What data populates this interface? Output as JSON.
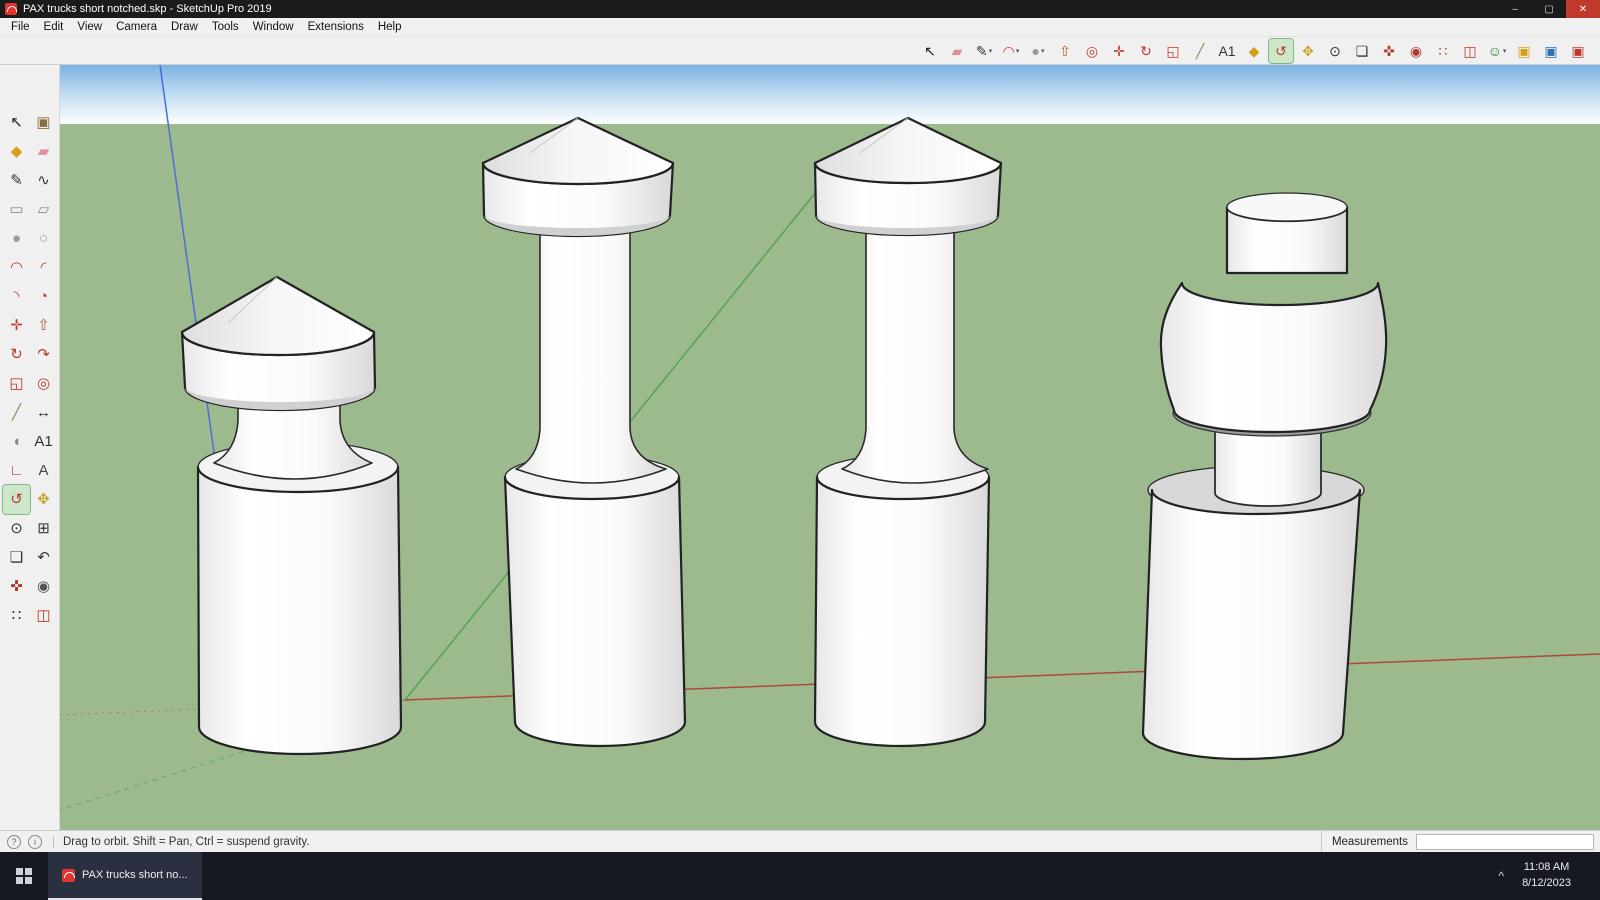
{
  "window": {
    "title": "PAX trucks short notched.skp - SketchUp Pro 2019",
    "controls": {
      "minimize": "–",
      "maximize": "▢",
      "close": "✕"
    }
  },
  "menu": {
    "items": [
      {
        "name": "menu-file",
        "label": "File"
      },
      {
        "name": "menu-edit",
        "label": "Edit"
      },
      {
        "name": "menu-view",
        "label": "View"
      },
      {
        "name": "menu-camera",
        "label": "Camera"
      },
      {
        "name": "menu-draw",
        "label": "Draw"
      },
      {
        "name": "menu-tools",
        "label": "Tools"
      },
      {
        "name": "menu-window",
        "label": "Window"
      },
      {
        "name": "menu-extensions",
        "label": "Extensions"
      },
      {
        "name": "menu-help",
        "label": "Help"
      }
    ]
  },
  "toolbar": {
    "icons": [
      {
        "name": "select-tool",
        "glyph": "↖",
        "color": "#1a1a1a"
      },
      {
        "name": "eraser-tool",
        "glyph": "▰",
        "color": "#e08e9b"
      },
      {
        "name": "line-tool",
        "glyph": "✎",
        "color": "#333333",
        "dropdown": true
      },
      {
        "name": "arc-tool",
        "glyph": "◠",
        "color": "#c0392b",
        "dropdown": true
      },
      {
        "name": "shapes-tool",
        "glyph": "●",
        "color": "#9a9a9a",
        "dropdown": true
      },
      {
        "name": "push-pull-tool",
        "glyph": "⇧",
        "color": "#b35c2a"
      },
      {
        "name": "offset-tool",
        "glyph": "◎",
        "color": "#c0392b"
      },
      {
        "name": "move-tool",
        "glyph": "✛",
        "color": "#c0392b"
      },
      {
        "name": "rotate-tool",
        "glyph": "↻",
        "color": "#c0392b"
      },
      {
        "name": "scale-tool",
        "glyph": "◱",
        "color": "#c0392b"
      },
      {
        "name": "tape-measure-tool",
        "glyph": "╱",
        "color": "#8a8a5a"
      },
      {
        "name": "text-tool",
        "glyph": "A1",
        "color": "#333333"
      },
      {
        "name": "paint-bucket-tool",
        "glyph": "◆",
        "color": "#d4a017"
      },
      {
        "name": "orbit-tool",
        "glyph": "↺",
        "color": "#c0392b",
        "active": true
      },
      {
        "name": "pan-tool",
        "glyph": "✥",
        "color": "#c9a227"
      },
      {
        "name": "zoom-tool",
        "glyph": "⊙",
        "color": "#333333"
      },
      {
        "name": "zoom-extents-tool",
        "glyph": "❏",
        "color": "#333333"
      },
      {
        "name": "position-camera-tool",
        "glyph": "✜",
        "color": "#b03a2e"
      },
      {
        "name": "look-around-tool",
        "glyph": "◉",
        "color": "#b03a2e"
      },
      {
        "name": "walk-tool",
        "glyph": "∷",
        "color": "#b03a2e"
      },
      {
        "name": "section-plane-tool",
        "glyph": "◫",
        "color": "#b03a2e"
      },
      {
        "name": "sign-in-avatar",
        "glyph": "☺",
        "color": "#2e7d32",
        "dropdown": true
      },
      {
        "name": "3d-warehouse-tool",
        "glyph": "▣",
        "color": "#d4a017"
      },
      {
        "name": "extension-warehouse-tool",
        "glyph": "▣",
        "color": "#2f6fb3"
      },
      {
        "name": "send-to-layout-tool",
        "glyph": "▣",
        "color": "#c0392b"
      }
    ]
  },
  "tool_palette": {
    "icons": [
      {
        "name": "select-tool",
        "glyph": "↖",
        "color": "#1a1a1a"
      },
      {
        "name": "make-component-tool",
        "glyph": "▣",
        "color": "#8a6d3b"
      },
      {
        "name": "paint-bucket-tool",
        "glyph": "◆",
        "color": "#d4a017"
      },
      {
        "name": "eraser-tool",
        "glyph": "▰",
        "color": "#e08e9b"
      },
      {
        "name": "line-tool",
        "glyph": "✎",
        "color": "#333333"
      },
      {
        "name": "freehand-tool",
        "glyph": "∿",
        "color": "#333333"
      },
      {
        "name": "rectangle-tool",
        "glyph": "▭",
        "color": "#8a8a8a"
      },
      {
        "name": "rotated-rectangle-tool",
        "glyph": "▱",
        "color": "#8a8a8a"
      },
      {
        "name": "circle-tool",
        "glyph": "●",
        "color": "#9a9a9a"
      },
      {
        "name": "polygon-tool",
        "glyph": "○",
        "color": "#9a9a9a"
      },
      {
        "name": "arc-tool",
        "glyph": "◠",
        "color": "#c0392b"
      },
      {
        "name": "two-point-arc-tool",
        "glyph": "◜",
        "color": "#c0392b"
      },
      {
        "name": "three-point-arc-tool",
        "glyph": "◝",
        "color": "#c0392b"
      },
      {
        "name": "pie-tool",
        "glyph": "◔",
        "color": "#c0392b"
      },
      {
        "name": "move-tool",
        "glyph": "✛",
        "color": "#c0392b"
      },
      {
        "name": "push-pull-tool",
        "glyph": "⇧",
        "color": "#b35c2a"
      },
      {
        "name": "rotate-tool",
        "glyph": "↻",
        "color": "#c0392b"
      },
      {
        "name": "follow-me-tool",
        "glyph": "↷",
        "color": "#c0392b"
      },
      {
        "name": "scale-tool",
        "glyph": "◱",
        "color": "#c0392b"
      },
      {
        "name": "offset-tool",
        "glyph": "◎",
        "color": "#c0392b"
      },
      {
        "name": "tape-measure-tool",
        "glyph": "╱",
        "color": "#8a8a5a"
      },
      {
        "name": "dimension-tool",
        "glyph": "↔",
        "color": "#333333"
      },
      {
        "name": "protractor-tool",
        "glyph": "◖",
        "color": "#888888"
      },
      {
        "name": "text-tool",
        "glyph": "A1",
        "color": "#333333"
      },
      {
        "name": "axes-tool",
        "glyph": "∟",
        "color": "#c0392b"
      },
      {
        "name": "3d-text-tool",
        "glyph": "A",
        "color": "#444444"
      },
      {
        "name": "orbit-tool",
        "glyph": "↺",
        "color": "#c0392b",
        "active": true
      },
      {
        "name": "pan-tool",
        "glyph": "✥",
        "color": "#c9a227"
      },
      {
        "name": "zoom-tool",
        "glyph": "⊙",
        "color": "#333333"
      },
      {
        "name": "zoom-window-tool",
        "glyph": "⊞",
        "color": "#333333"
      },
      {
        "name": "zoom-extents-tool",
        "glyph": "❏",
        "color": "#333333"
      },
      {
        "name": "previous-view-tool",
        "glyph": "↶",
        "color": "#333333"
      },
      {
        "name": "position-camera-tool",
        "glyph": "✜",
        "color": "#b03a2e"
      },
      {
        "name": "look-around-tool",
        "glyph": "◉",
        "color": "#555555"
      },
      {
        "name": "walk-tool",
        "glyph": "∷",
        "color": "#333333"
      },
      {
        "name": "section-plane-tool",
        "glyph": "◫",
        "color": "#c0392b"
      }
    ]
  },
  "viewport": {
    "sky": {
      "top": "#79b2e2",
      "mid": "#c2ddf3",
      "bottom": "#fdfefe"
    },
    "ground_color": "#9cba8e",
    "axes": {
      "blue_color": "#4a6fd6",
      "green_color": "#57a353",
      "red_color": "#b0473c"
    },
    "models": [
      "bollard-short",
      "bollard-tall-left",
      "bollard-tall-right",
      "stacked-cylinders"
    ]
  },
  "statusbar": {
    "help_glyph": "?",
    "info_glyph": "i",
    "status_text": "Drag to orbit. Shift = Pan, Ctrl = suspend gravity.",
    "measurements_label": "Measurements",
    "measurements_value": ""
  },
  "taskbar": {
    "app_label": "PAX trucks short no...",
    "tray": {
      "chevron": "^",
      "time": "11:08 AM",
      "date": "8/12/2023"
    }
  }
}
